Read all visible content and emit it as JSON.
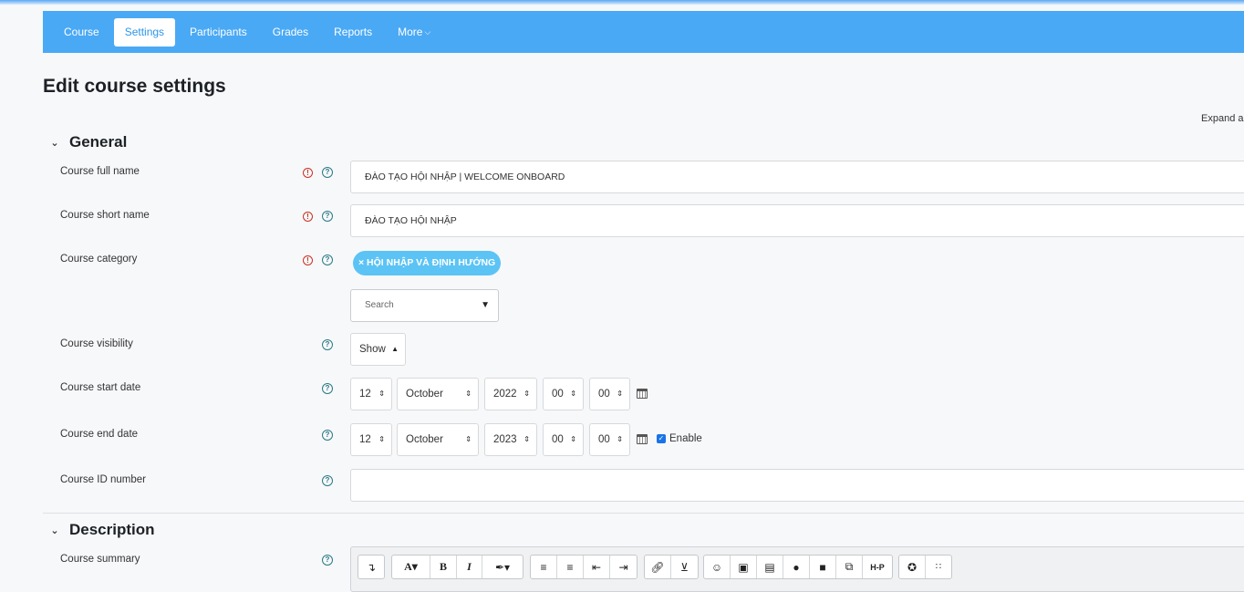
{
  "nav": {
    "items": [
      "Course",
      "Settings",
      "Participants",
      "Grades",
      "Reports",
      "More"
    ],
    "active": "Settings"
  },
  "page": {
    "title": "Edit course settings",
    "expand_all": "Expand a"
  },
  "general": {
    "title": "General",
    "full_name": {
      "label": "Course full name",
      "value": "ĐÀO TẠO HỘI NHẬP | WELCOME ONBOARD"
    },
    "short_name": {
      "label": "Course short name",
      "value": "ĐÀO TẠO HỘI NHẬP"
    },
    "category": {
      "label": "Course category",
      "chip": "× HỘI NHẬP VÀ ĐỊNH HƯỚNG",
      "search_placeholder": "Search"
    },
    "visibility": {
      "label": "Course visibility",
      "value": "Show"
    },
    "start_date": {
      "label": "Course start date",
      "day": "12",
      "month": "October",
      "year": "2022",
      "hour": "00",
      "minute": "00"
    },
    "end_date": {
      "label": "Course end date",
      "day": "12",
      "month": "October",
      "year": "2023",
      "hour": "00",
      "minute": "00",
      "enable_label": "Enable",
      "enabled": true
    },
    "id_number": {
      "label": "Course ID number",
      "value": ""
    }
  },
  "description": {
    "title": "Description",
    "summary_label": "Course summary"
  },
  "icons": {
    "required": "exclamation-circle-icon",
    "help": "question-circle-icon",
    "section_toggle": "chevron-down-icon",
    "calendar": "calendar-icon"
  },
  "editor_toolbar": {
    "hp_label": "H-P"
  },
  "colors": {
    "nav_bg": "#4aa9f5",
    "chip_bg": "#5cc3f5",
    "required": "#ca3120",
    "help": "#2a7a85"
  }
}
